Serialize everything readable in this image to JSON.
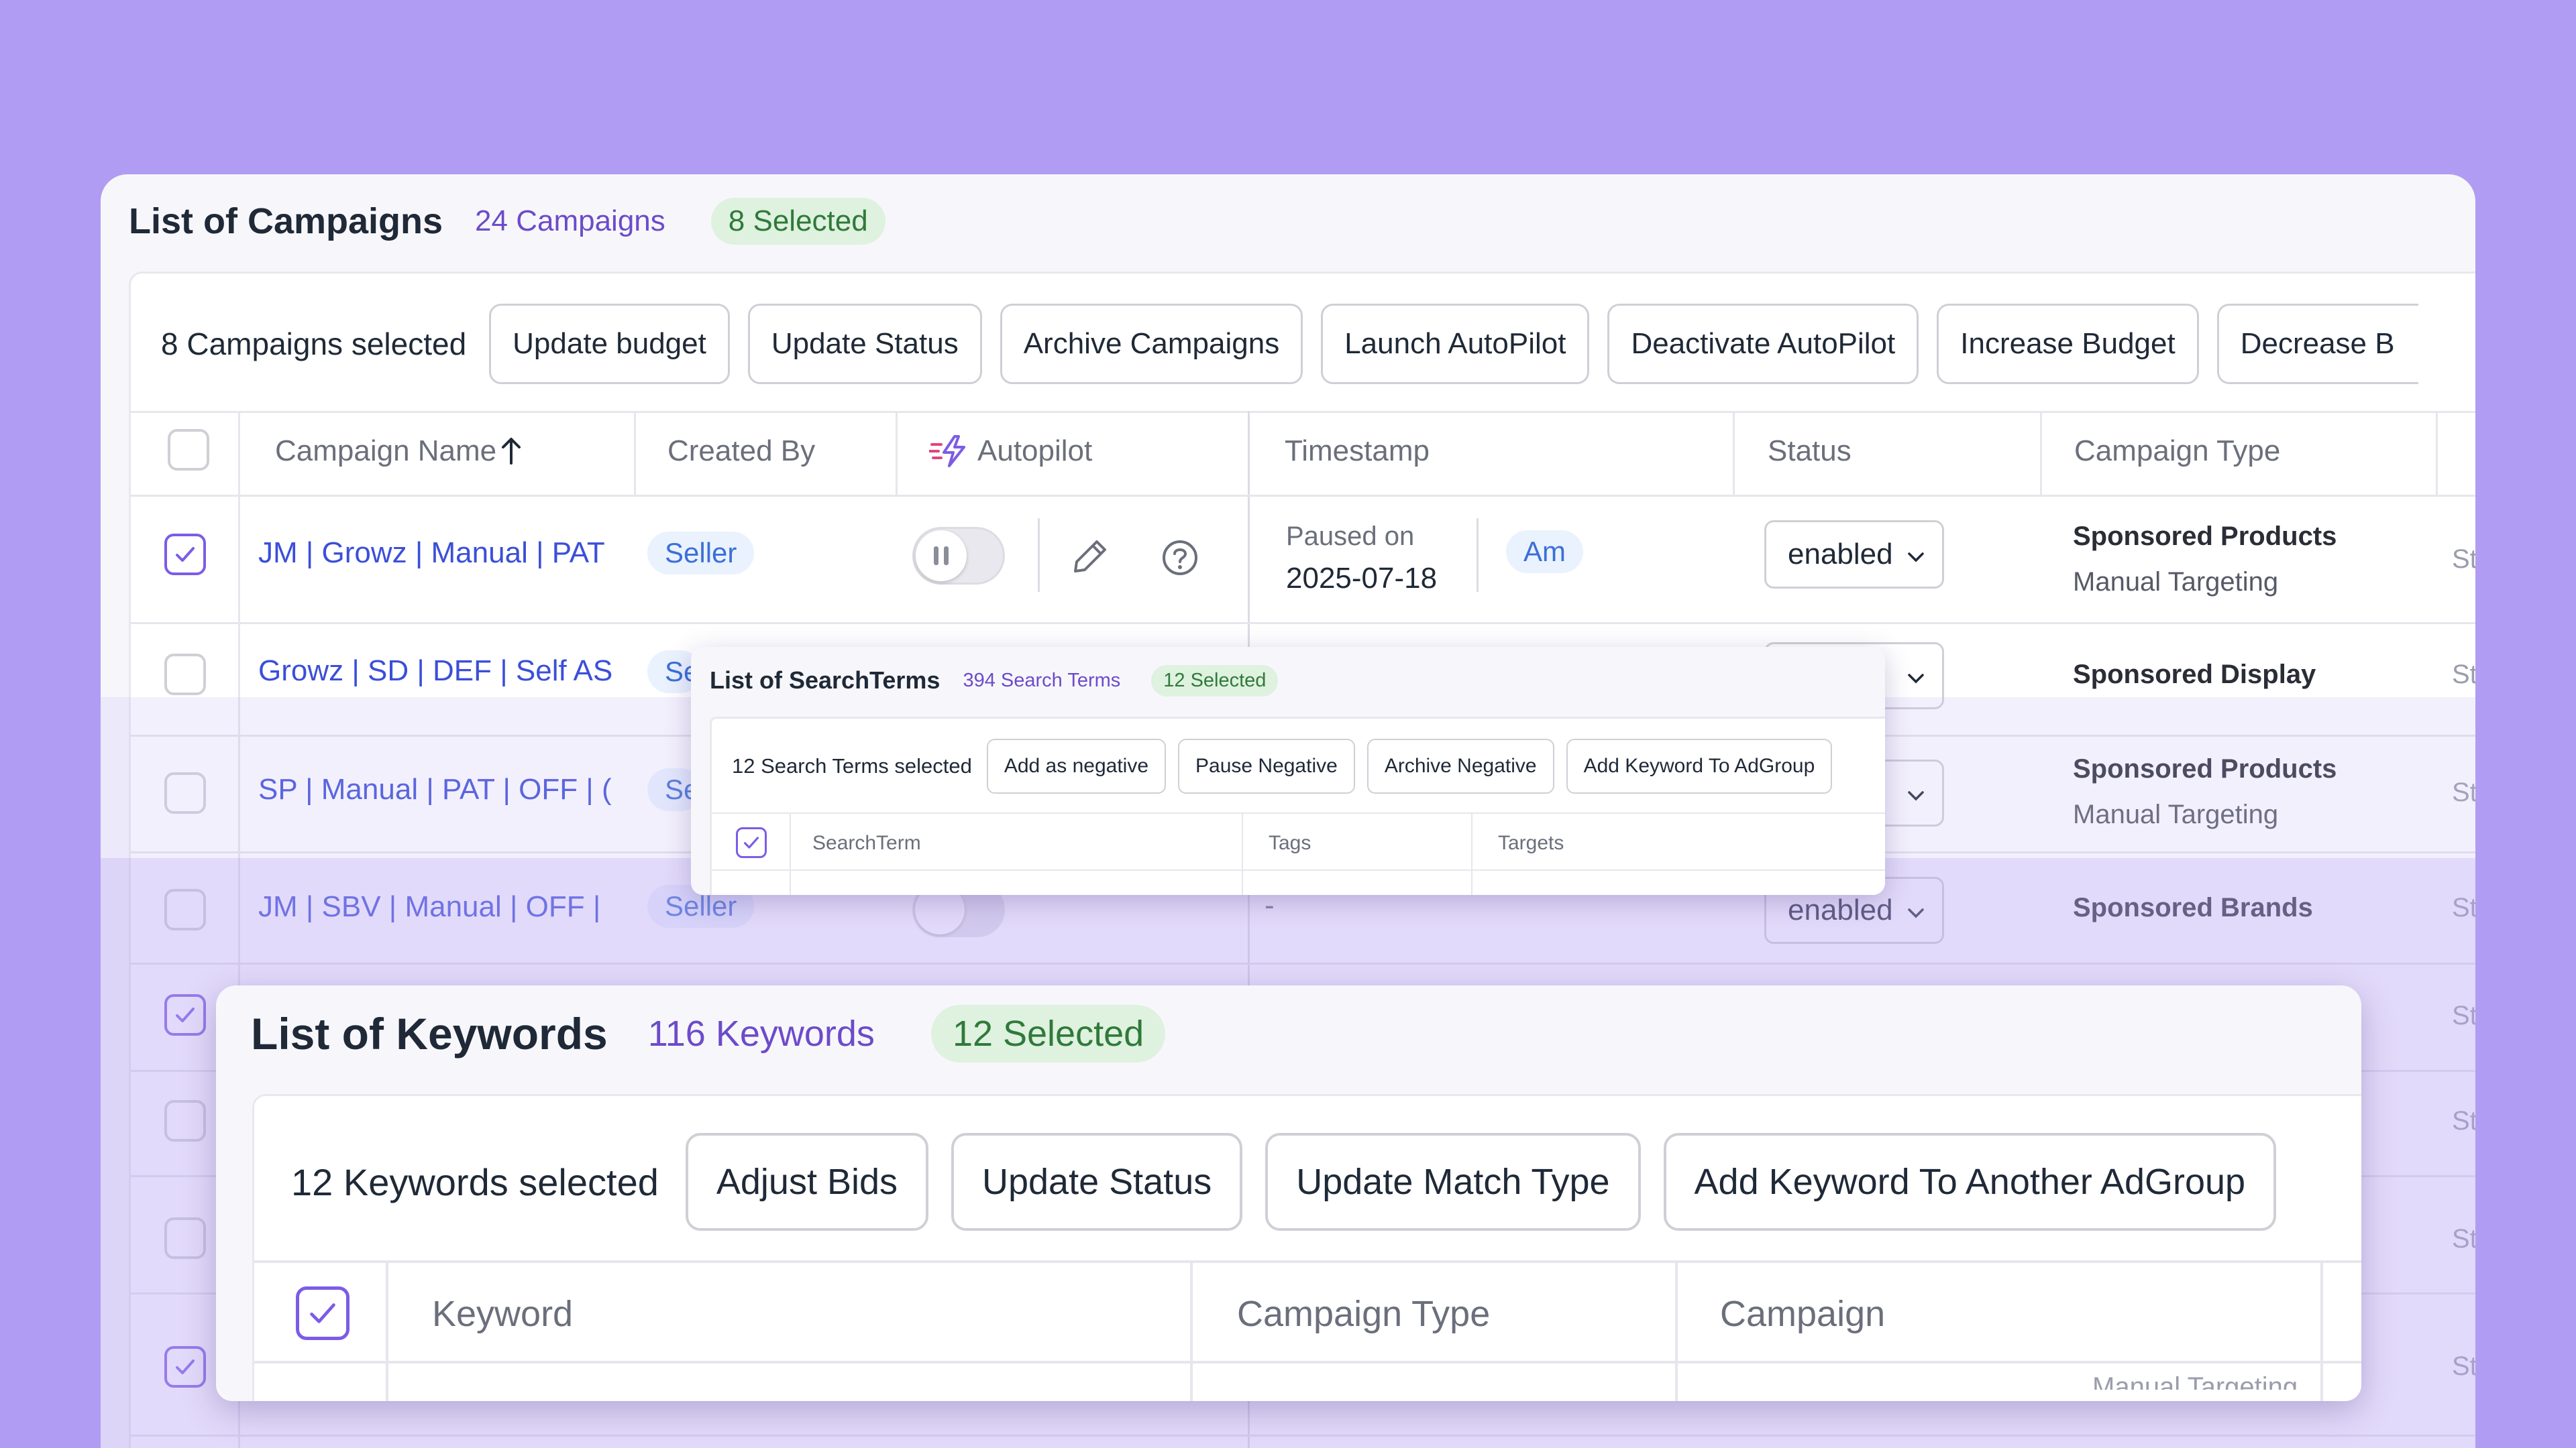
{
  "campaigns": {
    "title": "List of Campaigns",
    "count": "24 Campaigns",
    "selected": "8 Selected",
    "toolbar": {
      "selected_text": "8 Campaigns selected",
      "buttons": [
        "Update budget",
        "Update Status",
        "Archive Campaigns",
        "Launch AutoPilot",
        "Deactivate AutoPilot",
        "Increase Budget",
        "Decrease B"
      ]
    },
    "columns": [
      "Campaign Name",
      "Created By",
      "Autopilot",
      "Timestamp",
      "Status",
      "Campaign Type"
    ],
    "rows": [
      {
        "name": "JM | Growz | Manual | PAT",
        "created_by": "Seller",
        "timestamp_label": "Paused on",
        "timestamp": "2025-07-18",
        "actor": "Am",
        "status": "enabled",
        "type": "Sponsored Products",
        "subtype": "Manual Targeting",
        "trail": "St",
        "checked": true
      },
      {
        "name": "Growz | SD | DEF | Self AS",
        "created_by": "Se",
        "type": "Sponsored Display",
        "trail": "St",
        "checked": false
      },
      {
        "name": "SP | Manual | PAT | OFF | (",
        "created_by": "Se",
        "type": "Sponsored Products",
        "subtype": "Manual Targeting",
        "trail": "St",
        "checked": false
      },
      {
        "name": "JM | SBV | Manual | OFF |",
        "created_by": "Seller",
        "timestamp": "-",
        "status": "enabled",
        "type": "Sponsored Brands",
        "trail": "St",
        "checked": false
      }
    ],
    "trail_rows": [
      "St",
      "St",
      "St",
      "St"
    ],
    "colors": {
      "accent": "#7c5ce6",
      "link": "#3b4fd8",
      "background": "#b19cf3"
    }
  },
  "searchterms": {
    "title": "List of SearchTerms",
    "count": "394 Search Terms",
    "selected": "12 Selected",
    "toolbar": {
      "selected_text": "12 Search Terms selected",
      "buttons": [
        "Add as negative",
        "Pause Negative",
        "Archive Negative",
        "Add Keyword To AdGroup"
      ]
    },
    "columns": [
      "SearchTerm",
      "Tags",
      "Targets"
    ]
  },
  "keywords": {
    "title": "List of Keywords",
    "count": "116 Keywords",
    "selected": "12 Selected",
    "toolbar": {
      "selected_text": "12 Keywords selected",
      "buttons": [
        "Adjust Bids",
        "Update Status",
        "Update Match Type",
        "Add Keyword To Another AdGroup"
      ]
    },
    "columns": [
      "Keyword",
      "Campaign Type",
      "Campaign"
    ],
    "peek_text": "Manual Targeting"
  },
  "icons": [
    "sort-arrow-up-icon",
    "autopilot-bolt-icon",
    "pause-icon",
    "pencil-icon",
    "help-icon",
    "chevron-down-icon",
    "checkmark-icon"
  ]
}
